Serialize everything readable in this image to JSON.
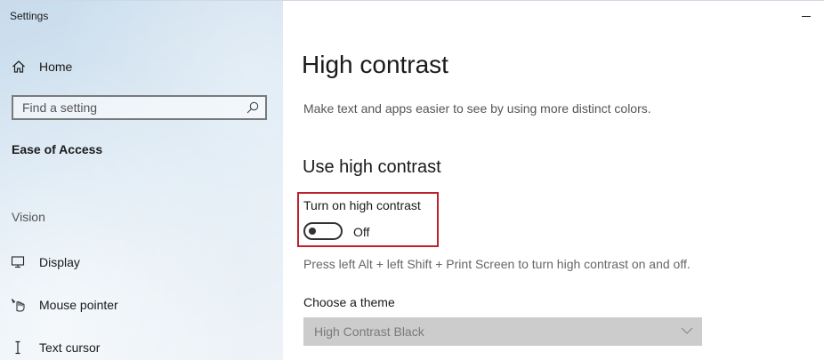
{
  "window": {
    "title": "Settings"
  },
  "sidebar": {
    "home_label": "Home",
    "search_placeholder": "Find a setting",
    "section_title": "Ease of Access",
    "group_label": "Vision",
    "items": [
      {
        "label": "Display",
        "icon": "monitor-icon"
      },
      {
        "label": "Mouse pointer",
        "icon": "mouse-pointer-icon"
      },
      {
        "label": "Text cursor",
        "icon": "text-cursor-icon"
      }
    ]
  },
  "main": {
    "title": "High contrast",
    "description": "Make text and apps easier to see by using more distinct colors.",
    "subheading": "Use high contrast",
    "toggle": {
      "label": "Turn on high contrast",
      "state_label": "Off",
      "on": false
    },
    "hint": "Press left Alt + left Shift + Print Screen to turn high contrast on and off.",
    "theme": {
      "label": "Choose a theme",
      "selected": "High Contrast Black",
      "disabled": true
    }
  },
  "colors": {
    "highlight_border": "#c0202a",
    "dropdown_disabled_bg": "#cccccc"
  }
}
